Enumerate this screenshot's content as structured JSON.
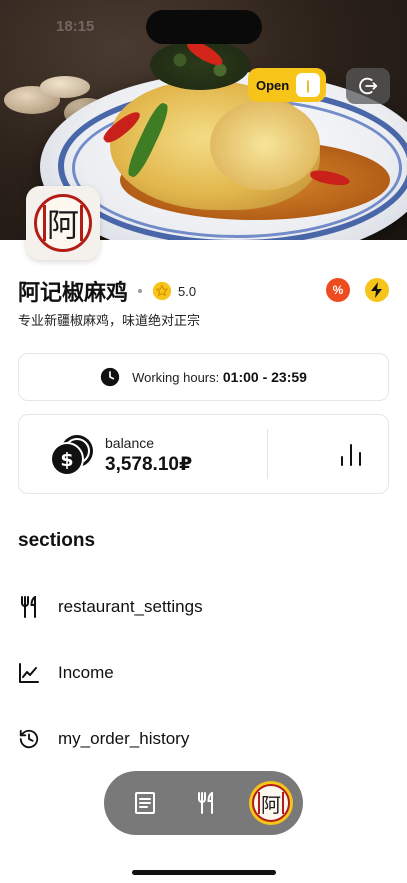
{
  "status_bar": {
    "time": "18:15"
  },
  "header": {
    "open_toggle_label": "Open",
    "open_toggle_state": "on",
    "cover_image": "chicken-dish-photo"
  },
  "restaurant": {
    "logo_char": "阿",
    "name": "阿记椒麻鸡",
    "rating": "5.0",
    "description": "专业新疆椒麻鸡，味道绝对正宗"
  },
  "hours": {
    "label": "Working hours:",
    "value": "01:00 - 23:59"
  },
  "balance": {
    "label": "balance",
    "value": "3,578.10₽"
  },
  "sections": {
    "title": "sections",
    "items": [
      {
        "label": "restaurant_settings",
        "icon": "fork-knife-icon"
      },
      {
        "label": "Income",
        "icon": "line-chart-icon"
      },
      {
        "label": "my_order_history",
        "icon": "history-icon"
      }
    ]
  },
  "bottom_nav": {
    "items": [
      "orders-icon",
      "menu-icon",
      "profile-avatar"
    ],
    "active": "profile-avatar"
  },
  "colors": {
    "accent_yellow": "#f7c41a",
    "discount_red": "#ee4b1f",
    "seal_red": "#b31d18"
  }
}
